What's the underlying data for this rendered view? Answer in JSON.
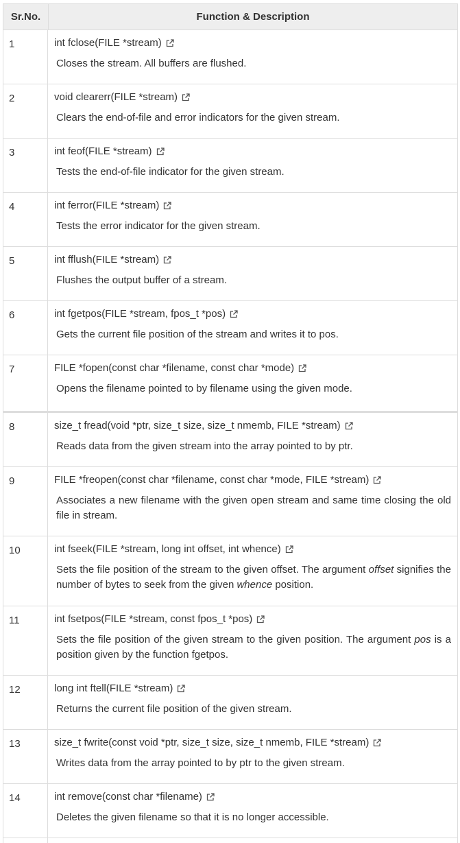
{
  "table": {
    "header": {
      "no": "Sr.No.",
      "fn": "Function & Description"
    },
    "link_icon": "external-link-icon",
    "rows": [
      {
        "no": "1",
        "sig": "int fclose(FILE *stream)",
        "desc": "Closes the stream. All buffers are flushed."
      },
      {
        "no": "2",
        "sig": "void clearerr(FILE *stream)",
        "desc": "Clears the end-of-file and error indicators for the given stream."
      },
      {
        "no": "3",
        "sig": "int feof(FILE *stream)",
        "desc": "Tests the end-of-file indicator for the given stream."
      },
      {
        "no": "4",
        "sig": "int ferror(FILE *stream)",
        "desc": "Tests the error indicator for the given stream."
      },
      {
        "no": "5",
        "sig": "int fflush(FILE *stream)",
        "desc": "Flushes the output buffer of a stream."
      },
      {
        "no": "6",
        "sig": "int fgetpos(FILE *stream, fpos_t *pos)",
        "desc": "Gets the current file position of the stream and writes it to pos."
      },
      {
        "no": "7",
        "sig": "FILE *fopen(const char *filename, const char *mode)",
        "desc": "Opens the filename pointed to by filename using the given mode."
      },
      {
        "no": "8",
        "sig": "size_t fread(void *ptr, size_t size, size_t nmemb, FILE *stream)",
        "desc": "Reads data from the given stream into the array pointed to by ptr."
      },
      {
        "no": "9",
        "sig": "FILE *freopen(const char *filename, const char *mode, FILE *stream)",
        "desc": "Associates a new filename with the given open stream and same time closing the old file in stream."
      },
      {
        "no": "10",
        "sig": "int fseek(FILE *stream, long int offset, int whence)",
        "desc_a": "Sets the file position of the stream to the given offset. The argument ",
        "desc_em1": "offset",
        "desc_b": " signifies the number of bytes to seek from the given ",
        "desc_em2": "whence",
        "desc_c": " position."
      },
      {
        "no": "11",
        "sig": "int fsetpos(FILE *stream, const fpos_t *pos)",
        "desc_a": "Sets the file position of the given stream to the given position. The argument ",
        "desc_em1": "pos",
        "desc_b": " is a position given by the function fgetpos."
      },
      {
        "no": "12",
        "sig": "long int ftell(FILE *stream)",
        "desc": "Returns the current file position of the given stream."
      },
      {
        "no": "13",
        "sig": "size_t fwrite(const void *ptr, size_t size, size_t nmemb, FILE *stream)",
        "desc": "Writes data from the array pointed to by ptr to the given stream."
      },
      {
        "no": "14",
        "sig": "int remove(const char *filename)",
        "desc": "Deletes the given filename so that it is no longer accessible."
      }
    ]
  }
}
